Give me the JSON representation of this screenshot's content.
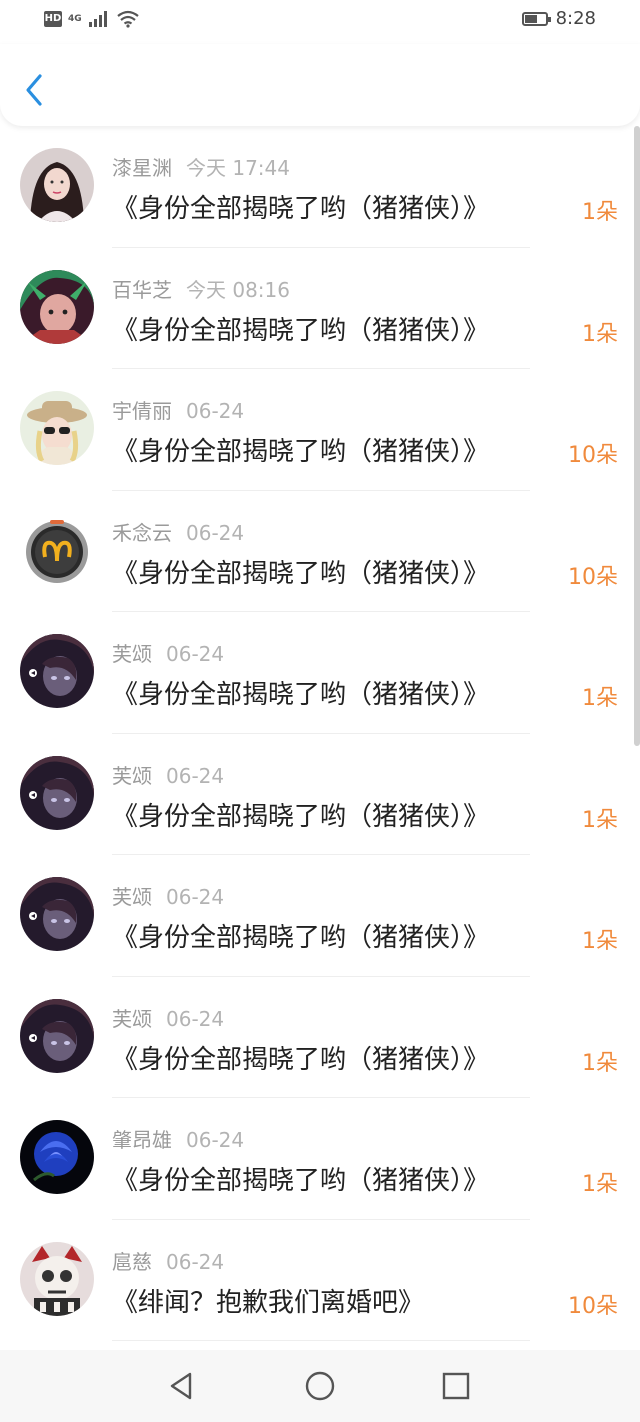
{
  "status_bar": {
    "hd_badge": "HD",
    "network": "4G",
    "time": "8:28"
  },
  "colors": {
    "accent_blue": "#2a8fe0",
    "flower_orange": "#f08a3c",
    "meta_gray": "#9a9a9a"
  },
  "nav": {
    "back_icon": "chevron-left-icon"
  },
  "list": {
    "items": [
      {
        "name": "漆星渊",
        "date": "今天 17:44",
        "title": "《身份全部揭晓了哟（猪猪侠）》",
        "flowers": "1朵",
        "avatar": "girl-portrait"
      },
      {
        "name": "百华芝",
        "date": "今天 08:16",
        "title": "《身份全部揭晓了哟（猪猪侠）》",
        "flowers": "1朵",
        "avatar": "green-hair-warrior"
      },
      {
        "name": "宇倩丽",
        "date": "06-24",
        "title": "《身份全部揭晓了哟（猪猪侠）》",
        "flowers": "10朵",
        "avatar": "hat-sunglasses"
      },
      {
        "name": "禾念云",
        "date": "06-24",
        "title": "《身份全部揭晓了哟（猪猪侠）》",
        "flowers": "10朵",
        "avatar": "aries-badge"
      },
      {
        "name": "芙颂",
        "date": "06-24",
        "title": "《身份全部揭晓了哟（猪猪侠）》",
        "flowers": "1朵",
        "avatar": "dark-anime"
      },
      {
        "name": "芙颂",
        "date": "06-24",
        "title": "《身份全部揭晓了哟（猪猪侠）》",
        "flowers": "1朵",
        "avatar": "dark-anime"
      },
      {
        "name": "芙颂",
        "date": "06-24",
        "title": "《身份全部揭晓了哟（猪猪侠）》",
        "flowers": "1朵",
        "avatar": "dark-anime"
      },
      {
        "name": "芙颂",
        "date": "06-24",
        "title": "《身份全部揭晓了哟（猪猪侠）》",
        "flowers": "1朵",
        "avatar": "dark-anime"
      },
      {
        "name": "肇昂雄",
        "date": "06-24",
        "title": "《身份全部揭晓了哟（猪猪侠）》",
        "flowers": "1朵",
        "avatar": "blue-rose"
      },
      {
        "name": "扈慈",
        "date": "06-24",
        "title": "《绯闻？抱歉我们离婚吧》",
        "flowers": "10朵",
        "avatar": "skull-character"
      }
    ]
  },
  "system_nav": {
    "back": "triangle-back-icon",
    "home": "circle-home-icon",
    "recents": "square-recents-icon"
  }
}
